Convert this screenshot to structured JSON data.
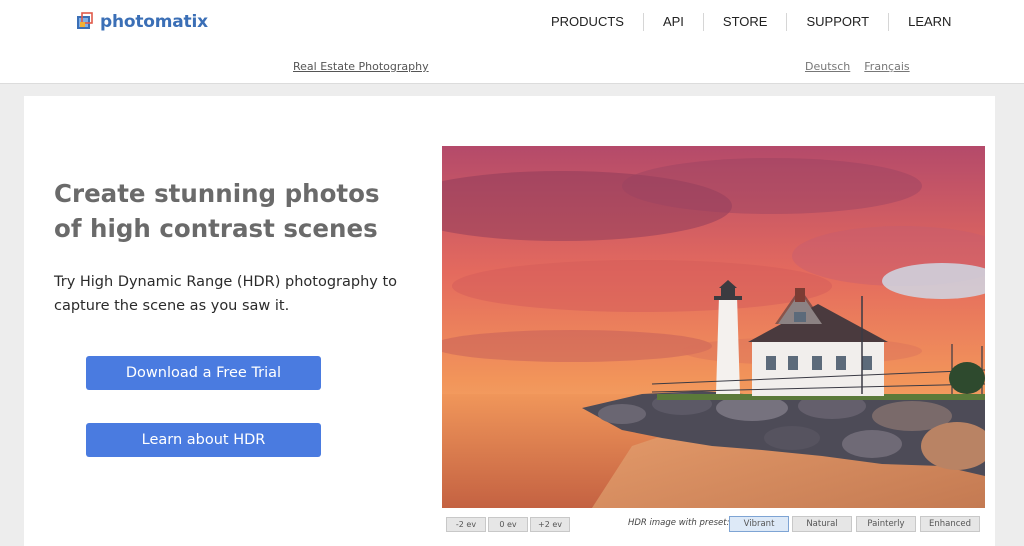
{
  "brand": {
    "name": "photomatix",
    "color": "#3b6fb6"
  },
  "nav": {
    "items": [
      {
        "label": "PRODUCTS"
      },
      {
        "label": "API"
      },
      {
        "label": "STORE"
      },
      {
        "label": "SUPPORT"
      },
      {
        "label": "LEARN"
      }
    ]
  },
  "subnav": {
    "link": "Real Estate Photography"
  },
  "languages": [
    {
      "label": "Deutsch"
    },
    {
      "label": "Français"
    }
  ],
  "hero": {
    "headline_line1": "Create stunning photos",
    "headline_line2": "of high contrast scenes",
    "sub_line1": "Try High Dynamic Range (HDR) photography to",
    "sub_line2": "capture the scene as you saw it.",
    "cta_trial": "Download a Free Trial",
    "cta_learn": "Learn about HDR",
    "cta_color": "#4a7be0"
  },
  "photo": {
    "alt": "Lighthouse on a rocky shore at sunset",
    "ev_buttons": [
      {
        "label": "-2 ev"
      },
      {
        "label": "0 ev"
      },
      {
        "label": "+2 ev"
      }
    ],
    "preset_label": "HDR image with preset:",
    "presets": [
      {
        "label": "Vibrant",
        "active": true
      },
      {
        "label": "Natural",
        "active": false
      },
      {
        "label": "Painterly",
        "active": false
      },
      {
        "label": "Enhanced",
        "active": false
      }
    ]
  }
}
